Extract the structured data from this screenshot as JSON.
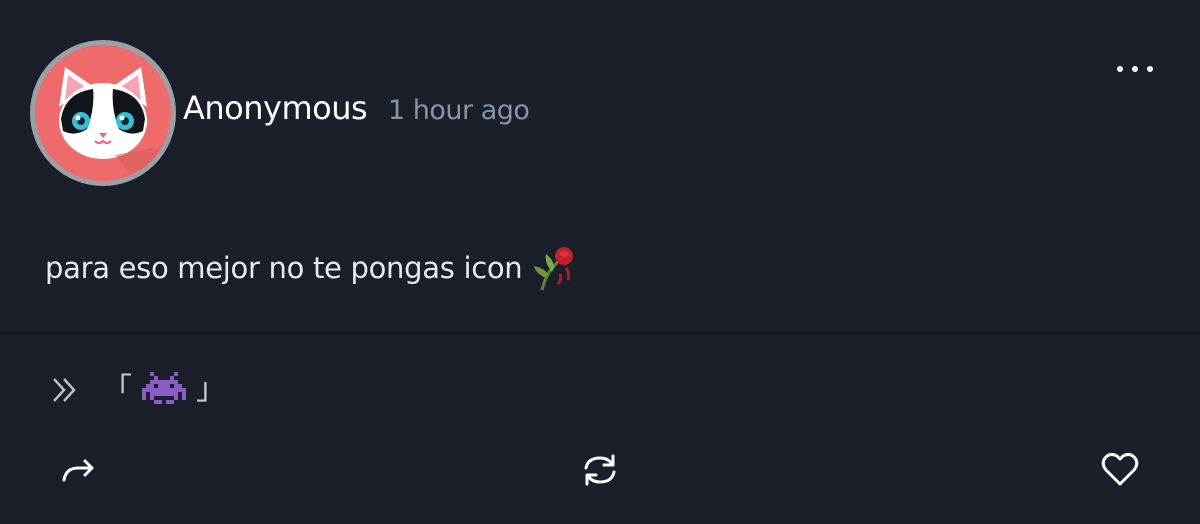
{
  "post": {
    "author": "Anonymous",
    "timestamp": "1 hour ago",
    "message": "para eso mejor no te pongas icon",
    "message_emoji": "wilted-rose-icon"
  },
  "signature": {
    "prefix_icon": "double-chevron-right-icon",
    "open_bracket": "「",
    "emoji": "space-invader-icon",
    "close_bracket": "」"
  },
  "actions": {
    "share": "share-icon",
    "repost": "repost-icon",
    "like": "heart-icon"
  },
  "colors": {
    "background": "#1b1f2a",
    "avatar_bg": "#ef6a6a",
    "avatar_ring": "#9aa0a8",
    "timestamp": "#8a93a3",
    "text": "#e8e9ec"
  }
}
